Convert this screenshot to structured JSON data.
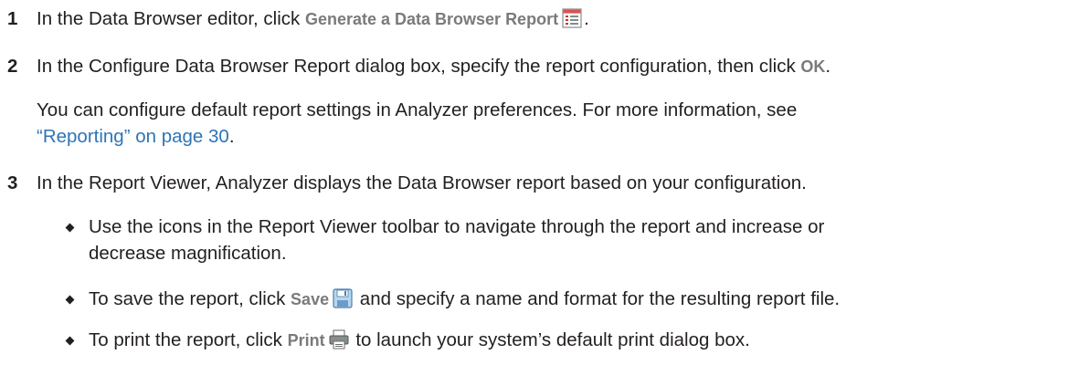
{
  "steps": [
    {
      "number": "1",
      "text_before": "In the Data Browser editor, click ",
      "gui": "Generate a Data Browser Report",
      "text_after": ".",
      "icon": "report-icon"
    },
    {
      "number": "2",
      "text_before": "In the Configure Data Browser Report dialog box, specify the report configuration, then click ",
      "gui": "OK",
      "text_after": ".",
      "note_line1": "You can configure default report settings in Analyzer preferences. For more information, see",
      "note_link": "“Reporting” on page 30",
      "note_after": "."
    },
    {
      "number": "3",
      "text": "In the Report Viewer, Analyzer displays the Data Browser report based on your configuration.",
      "bullets": [
        {
          "line1": "Use the icons in the Report Viewer toolbar to navigate through the report and increase or",
          "line2": "decrease magnification."
        },
        {
          "text_before": "To save the report, click ",
          "gui": "Save",
          "text_after": " and specify a name and format for the resulting report file.",
          "icon": "save-icon"
        },
        {
          "text_before": "To print the report, click ",
          "gui": "Print",
          "text_after": " to launch your system’s default print dialog box.",
          "icon": "print-icon"
        }
      ]
    }
  ]
}
